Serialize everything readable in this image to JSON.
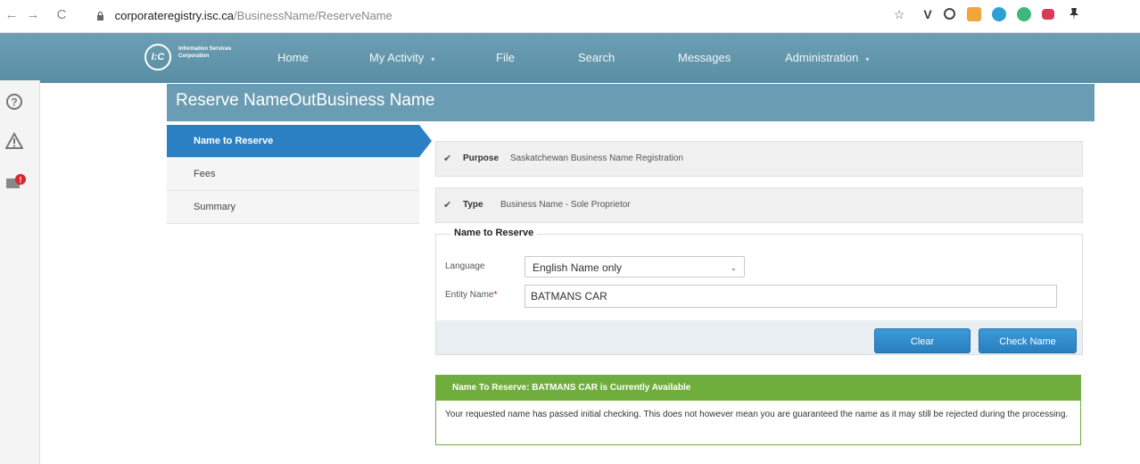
{
  "browser": {
    "back": "←",
    "forward": "→",
    "reload": "C",
    "url_host": "corporateregistry.isc.ca",
    "url_path": "/BusinessName/ReserveName",
    "star": "☆",
    "extensions": [
      "V",
      "pin-icon"
    ]
  },
  "nav": {
    "logo_mark": "I:C",
    "logo_text": "Information Services Corporation",
    "items": [
      "Home",
      "My Activity",
      "File",
      "Search",
      "Messages",
      "Administration"
    ],
    "dropdown_caret": "▾"
  },
  "page": {
    "title": "Reserve Name - Business Name",
    "overlap_title": "Reserve NameOutBusiness Name"
  },
  "steps": [
    "Name to Reserve",
    "Fees",
    "Summary"
  ],
  "summary": {
    "purpose_label": "Purpose",
    "purpose_value": "Saskatchewan Business Name Registration",
    "type_label": "Type",
    "type_value": "Business Name - Sole Proprietor"
  },
  "form": {
    "legend": "Name to Reserve",
    "language_label": "Language",
    "language_value": "English Name only",
    "entity_label": "Entity Name",
    "required_mark": "*",
    "entity_value": "BATMANS CAR",
    "clear_label": "Clear",
    "check_label": "Check Name"
  },
  "alert": {
    "title": "Name To Reserve: BATMANS CAR is Currently Available",
    "body": "Your requested name has passed initial checking. This does not however mean you are guaranteed the name as it may still be rejected during the processing."
  },
  "colors": {
    "nav_bg": "#5f93a9",
    "title_band": "#6a9db3",
    "active_step": "#2b80c4",
    "button": "#2f88c8",
    "success": "#6fae3d"
  }
}
